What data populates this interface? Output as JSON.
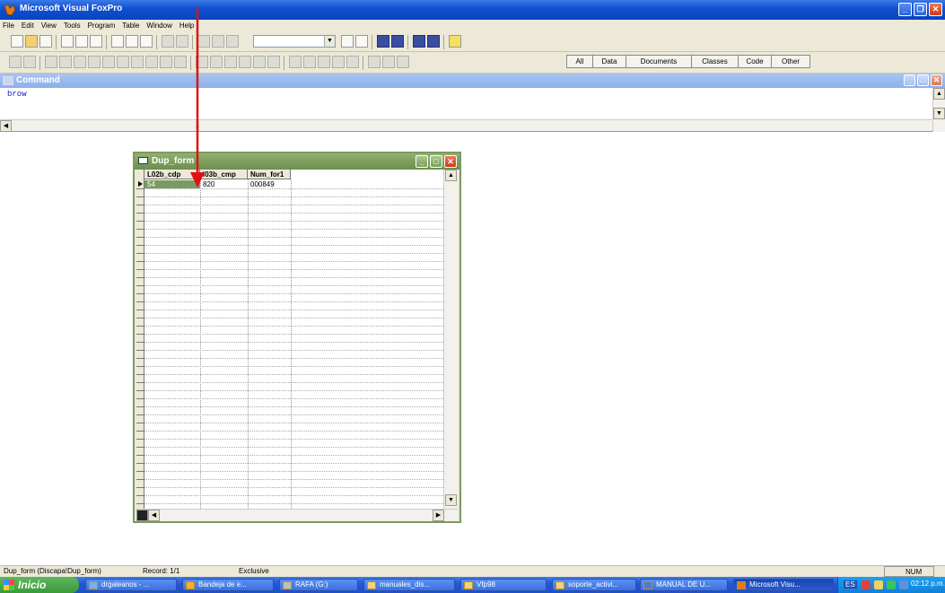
{
  "app": {
    "title": "Microsoft Visual FoxPro"
  },
  "menu": [
    "File",
    "Edit",
    "View",
    "Tools",
    "Program",
    "Table",
    "Window",
    "Help"
  ],
  "project_tabs": [
    "All",
    "Data",
    "Documents",
    "Classes",
    "Code",
    "Other"
  ],
  "command_window": {
    "title": "Command",
    "text": "brow"
  },
  "browse": {
    "title": "Dup_form",
    "columns": [
      "L02b_cdp",
      "l03b_cmp",
      "Num_for1"
    ],
    "rows": [
      [
        "54",
        "820",
        "000849"
      ]
    ]
  },
  "statusbar": {
    "table": "Dup_form (Discapa!Dup_form)",
    "record": "Record: 1/1",
    "mode": "Exclusive",
    "num": "NUM"
  },
  "taskbar": {
    "start": "Inicio",
    "tasks": [
      "drgaleanos - ...",
      "Bandeja de e...",
      "RAFA (G:)",
      "manuales_dis...",
      "Vfp98",
      "soporte_activi...",
      "MANUAL DE U...",
      "Microsoft Visu..."
    ],
    "tray": {
      "lang": "ES",
      "clock": "02:12 p.m."
    }
  },
  "colors": {
    "title_blue": "#0e4fd0",
    "browse_green": "#7a9a60",
    "annotation_red": "#e01010"
  }
}
